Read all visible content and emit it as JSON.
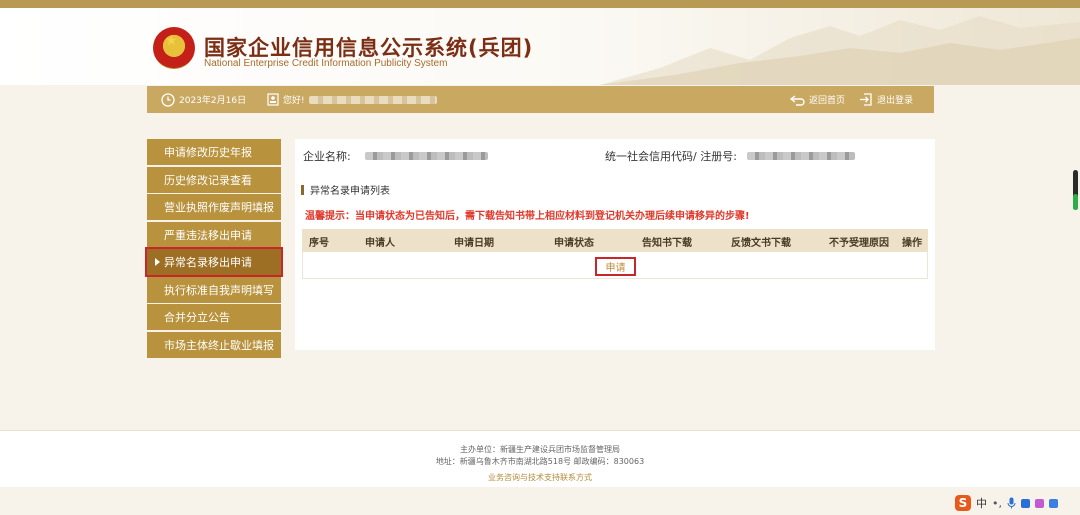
{
  "header": {
    "title_cn": "国家企业信用信息公示系统(兵团)",
    "title_en": "National Enterprise Credit Information Publicity System",
    "emblem_icon": "national-emblem-icon"
  },
  "topbar": {
    "date": "2023年2月16日",
    "greeting": "您好!",
    "home_label": "返回首页",
    "logout_label": "退出登录"
  },
  "sidebar": {
    "items": [
      {
        "label": "申请修改历史年报"
      },
      {
        "label": "历史修改记录查看"
      },
      {
        "label": "营业执照作废声明填报"
      },
      {
        "label": "严重违法移出申请"
      },
      {
        "label": "异常名录移出申请"
      },
      {
        "label": "执行标准自我声明填写"
      },
      {
        "label": "合并分立公告"
      },
      {
        "label": "市场主体终止歇业填报"
      }
    ],
    "active_index": 4
  },
  "main": {
    "company_name_label": "企业名称:",
    "credit_code_label": "统一社会信用代码/ 注册号:",
    "section_title": "异常名录申请列表",
    "tip": "温馨提示：当申请状态为已告知后，需下载告知书带上相应材料到登记机关办理后续申请移异的步骤!",
    "columns": [
      "序号",
      "申请人",
      "申请日期",
      "申请状态",
      "告知书下载",
      "反馈文书下载",
      "不予受理原因",
      "操作"
    ],
    "apply_label": "申请"
  },
  "footer": {
    "host": "主办单位：新疆生产建设兵团市场监督管理局",
    "address": "地址：新疆乌鲁木齐市南湖北路518号 邮政编码：830063",
    "support_link": "业务咨询与技术支持联系方式"
  },
  "ime": {
    "logo": "S",
    "mode": "中"
  },
  "colors": {
    "brand_gold": "#c9a862",
    "sidebar_gold": "#b8923d",
    "title_red": "#7b2e14",
    "warning_red": "#e0392b",
    "highlight_red": "#c7262a"
  }
}
